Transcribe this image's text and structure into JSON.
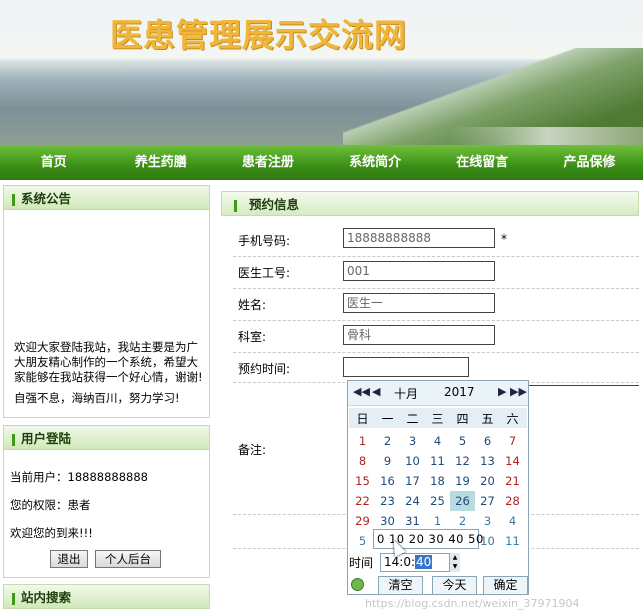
{
  "site": {
    "title": "医患管理展示交流网"
  },
  "nav": [
    "首页",
    "养生药膳",
    "患者注册",
    "系统简介",
    "在线留言",
    "产品保修"
  ],
  "notice": {
    "title": "系统公告",
    "text": "欢迎大家登陆我站，我站主要是为广大朋友精心制作的一个系统，希望大家能够在我站获得一个好心情，谢谢!",
    "text_cut": "自强不息，海纳百川，努力学习!"
  },
  "login": {
    "title": "用户登陆",
    "current_user": "当前用户：18888888888",
    "role": "您的权限：患者",
    "welcome": "欢迎您的到来!!!",
    "logout": "退出",
    "backend": "个人后台"
  },
  "search": {
    "title": "站内搜索"
  },
  "form": {
    "title": "预约信息",
    "phone_label": "手机号码:",
    "phone_value": "18888888888",
    "required_mark": "*",
    "doctor_id_label": "医生工号:",
    "doctor_id_value": "001",
    "name_label": "姓名:",
    "name_value": "医生一",
    "dept_label": "科室:",
    "dept_value": "骨科",
    "time_label": "预约时间:",
    "time_value": "",
    "remark_label": "备注:"
  },
  "calendar": {
    "nav_prev_year": "◀◀",
    "nav_prev_month": "◀",
    "month": "十月",
    "year": "2017",
    "nav_next_month": "▶",
    "nav_next_year": "▶▶",
    "weekdays": [
      "日",
      "一",
      "二",
      "三",
      "四",
      "五",
      "六"
    ],
    "weeks": [
      [
        "1",
        "2",
        "3",
        "4",
        "5",
        "6",
        "7"
      ],
      [
        "8",
        "9",
        "10",
        "11",
        "12",
        "13",
        "14"
      ],
      [
        "15",
        "16",
        "17",
        "18",
        "19",
        "20",
        "21"
      ],
      [
        "22",
        "23",
        "24",
        "25",
        "26",
        "27",
        "28"
      ],
      [
        "29",
        "30",
        "31",
        "1",
        "2",
        "3",
        "4"
      ],
      [
        "5",
        "",
        "",
        "",
        "",
        "10",
        "11"
      ]
    ],
    "today": "26",
    "minute_picker": "0 10 20 30 40 50",
    "time_label": "时间",
    "time_hour": "14",
    "time_sep1": ":",
    "time_min_tens": "0",
    "time_sep2": ":",
    "time_sel": "40",
    "clear": "清空",
    "today_btn": "今天",
    "ok": "确定",
    "colors": {
      "weekend": "#b22222",
      "weekday": "#1d4a7a",
      "other_month": "#3a7aa0"
    }
  },
  "watermark": "https://blog.csdn.net/weixin_37971904"
}
